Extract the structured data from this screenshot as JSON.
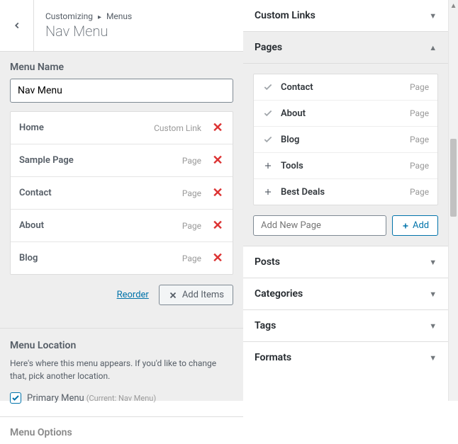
{
  "header": {
    "breadcrumb_root": "Customizing",
    "breadcrumb_current": "Menus",
    "title": "Nav Menu"
  },
  "menu_name": {
    "label": "Menu Name",
    "value": "Nav Menu"
  },
  "menu_items": [
    {
      "label": "Home",
      "type": "Custom Link"
    },
    {
      "label": "Sample Page",
      "type": "Page"
    },
    {
      "label": "Contact",
      "type": "Page"
    },
    {
      "label": "About",
      "type": "Page"
    },
    {
      "label": "Blog",
      "type": "Page"
    }
  ],
  "actions": {
    "reorder": "Reorder",
    "add_items": "Add Items"
  },
  "location": {
    "label": "Menu Location",
    "description": "Here's where this menu appears. If you'd like to change that, pick another location.",
    "primary_label": "Primary Menu",
    "current": "(Current: Nav Menu)"
  },
  "options": {
    "label": "Menu Options"
  },
  "right": {
    "sections": {
      "custom_links": "Custom Links",
      "pages": "Pages",
      "posts": "Posts",
      "categories": "Categories",
      "tags": "Tags",
      "formats": "Formats"
    },
    "pages_list": [
      {
        "name": "Contact",
        "type": "Page",
        "added": true
      },
      {
        "name": "About",
        "type": "Page",
        "added": true
      },
      {
        "name": "Blog",
        "type": "Page",
        "added": true
      },
      {
        "name": "Tools",
        "type": "Page",
        "added": false
      },
      {
        "name": "Best Deals",
        "type": "Page",
        "added": false
      }
    ],
    "add_page_placeholder": "Add New Page",
    "add_btn": "Add"
  }
}
